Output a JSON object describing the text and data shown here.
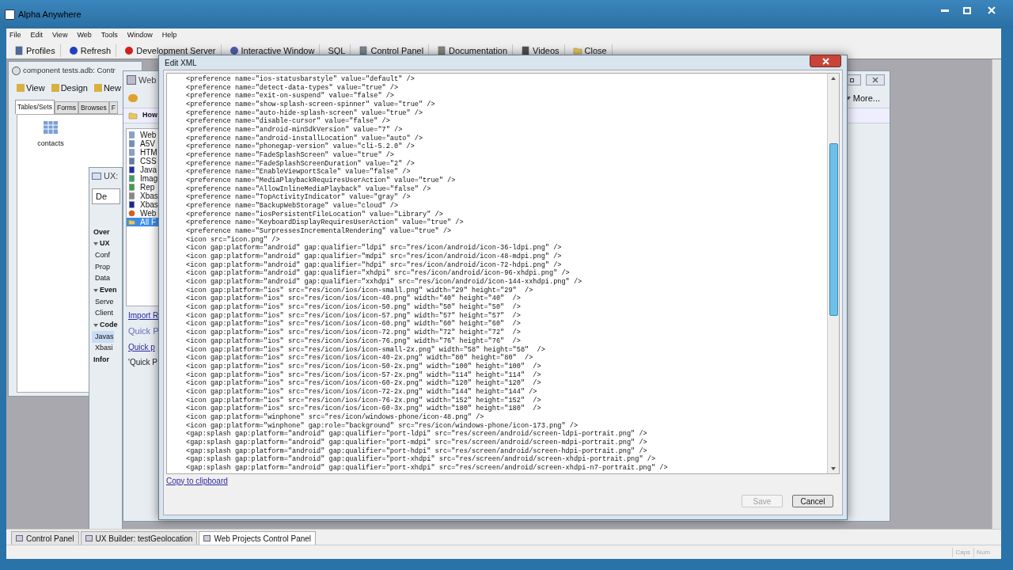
{
  "app": {
    "title": "Alpha Anywhere"
  },
  "menu": [
    "File",
    "Edit",
    "View",
    "Web",
    "Tools",
    "Window",
    "Help"
  ],
  "toolbar": [
    {
      "label": "Profiles",
      "kind": "monitor"
    },
    {
      "label": "Refresh",
      "kind": "refresh"
    },
    {
      "label": "Development Server",
      "kind": "dot"
    },
    {
      "label": "Interactive Window",
      "kind": "globe"
    },
    {
      "label": "SQL",
      "kind": "none"
    },
    {
      "label": "Control Panel",
      "kind": "panel"
    },
    {
      "label": "Documentation",
      "kind": "book"
    },
    {
      "label": "Videos",
      "kind": "film"
    },
    {
      "label": "Close",
      "kind": "folder"
    }
  ],
  "component_window": {
    "title": "component tests.adb: Contr",
    "toolbar": [
      "View",
      "Design",
      "New"
    ],
    "tabs": [
      {
        "label": "Tables/Sets",
        "selected": true
      },
      {
        "label": "Forms",
        "selected": false
      },
      {
        "label": "Browses",
        "selected": false
      },
      {
        "label": "F",
        "selected": false
      }
    ],
    "items": [
      "contacts"
    ]
  },
  "ux_window": {
    "title": "UX:",
    "button": "De",
    "entries": [
      {
        "label": "Over",
        "kind": "header",
        "selected": false
      },
      {
        "label": "UX",
        "kind": "group",
        "selected": false
      },
      {
        "label": "Conf",
        "kind": "item",
        "selected": false
      },
      {
        "label": "Prop",
        "kind": "item",
        "selected": false
      },
      {
        "label": "Data",
        "kind": "item",
        "selected": false
      },
      {
        "label": "Even",
        "kind": "group",
        "selected": false
      },
      {
        "label": "Serve",
        "kind": "item",
        "selected": false
      },
      {
        "label": "Client",
        "kind": "item",
        "selected": false
      },
      {
        "label": "Code",
        "kind": "group",
        "selected": false
      },
      {
        "label": "Javas",
        "kind": "item",
        "selected": true
      },
      {
        "label": "Xbasi",
        "kind": "item",
        "selected": false
      },
      {
        "label": "Infor",
        "kind": "header",
        "selected": false
      }
    ]
  },
  "web_window": {
    "title": "Web",
    "header": "How",
    "more": "More...",
    "files": [
      {
        "label": "Web",
        "kind": "page",
        "selected": false
      },
      {
        "label": "A5V",
        "kind": "pages",
        "selected": false
      },
      {
        "label": "HTM",
        "kind": "page",
        "selected": false
      },
      {
        "label": "CSS",
        "kind": "css",
        "selected": false
      },
      {
        "label": "Java",
        "kind": "js",
        "selected": false
      },
      {
        "label": "Imag",
        "kind": "image",
        "selected": false
      },
      {
        "label": "Rep",
        "kind": "report",
        "selected": false
      },
      {
        "label": "Xbas",
        "kind": "book",
        "selected": false
      },
      {
        "label": "Xbas",
        "kind": "xb",
        "selected": false
      },
      {
        "label": "Web",
        "kind": "ball",
        "selected": false
      },
      {
        "label": "All F",
        "kind": "folder",
        "selected": true
      }
    ],
    "links": [
      {
        "label": "Import R",
        "kind": "link"
      },
      {
        "label": "Quick P",
        "kind": "heading"
      },
      {
        "label": "Quick p",
        "kind": "link"
      },
      {
        "label": "'Quick P",
        "kind": "text"
      }
    ]
  },
  "dialog": {
    "title": "Edit XML",
    "link": "Copy to clipboard",
    "lines": [
      "<preference name=\"ios-statusbarstyle\" value=\"default\" />",
      "<preference name=\"detect-data-types\" value=\"true\" />",
      "<preference name=\"exit-on-suspend\" value=\"false\" />",
      "<preference name=\"show-splash-screen-spinner\" value=\"true\" />",
      "<preference name=\"auto-hide-splash-screen\" value=\"true\" />",
      "<preference name=\"disable-cursor\" value=\"false\" />",
      "<preference name=\"android-minSdkVersion\" value=\"7\" />",
      "<preference name=\"android-installLocation\" value=\"auto\" />",
      "<preference name=\"phonegap-version\" value=\"cli-5.2.0\" />",
      "<preference name=\"FadeSplashScreen\" value=\"true\" />",
      "<preference name=\"FadeSplashScreenDuration\" value=\"2\" />",
      "<preference name=\"EnableViewportScale\" value=\"false\" />",
      "<preference name=\"MediaPlaybackRequiresUserAction\" value=\"true\" />",
      "<preference name=\"AllowInlineMediaPlayback\" value=\"false\" />",
      "<preference name=\"TopActivityIndicator\" value=\"gray\" />",
      "<preference name=\"BackupWebStorage\" value=\"cloud\" />",
      "<preference name=\"iosPersistentFileLocation\" value=\"Library\" />",
      "<preference name=\"KeyboardDisplayRequiresUserAction\" value=\"true\" />",
      "<preference name=\"SurpressesIncrementalRendering\" value=\"true\" />",
      "<icon src=\"icon.png\" />",
      "<icon gap:platform=\"android\" gap:qualifier=\"ldpi\" src=\"res/icon/android/icon-36-ldpi.png\" />",
      "<icon gap:platform=\"android\" gap:qualifier=\"mdpi\" src=\"res/icon/android/icon-48-mdpi.png\" />",
      "<icon gap:platform=\"android\" gap:qualifier=\"hdpi\" src=\"res/icon/android/icon-72-hdpi.png\" />",
      "<icon gap:platform=\"android\" gap:qualifier=\"xhdpi\" src=\"res/icon/android/icon-96-xhdpi.png\" />",
      "<icon gap:platform=\"android\" gap:qualifier=\"xxhdpi\" src=\"res/icon/android/icon-144-xxhdpi.png\" />",
      "<icon gap:platform=\"ios\" src=\"res/icon/ios/icon-small.png\" width=\"29\" height=\"29\"  />",
      "<icon gap:platform=\"ios\" src=\"res/icon/ios/icon-40.png\" width=\"40\" height=\"40\"  />",
      "<icon gap:platform=\"ios\" src=\"res/icon/ios/icon-50.png\" width=\"50\" height=\"50\"  />",
      "<icon gap:platform=\"ios\" src=\"res/icon/ios/icon-57.png\" width=\"57\" height=\"57\"  />",
      "<icon gap:platform=\"ios\" src=\"res/icon/ios/icon-60.png\" width=\"60\" height=\"60\"  />",
      "<icon gap:platform=\"ios\" src=\"res/icon/ios/icon-72.png\" width=\"72\" height=\"72\"  />",
      "<icon gap:platform=\"ios\" src=\"res/icon/ios/icon-76.png\" width=\"76\" height=\"76\"  />",
      "<icon gap:platform=\"ios\" src=\"res/icon/ios/icon-small-2x.png\" width=\"58\" height=\"58\"  />",
      "<icon gap:platform=\"ios\" src=\"res/icon/ios/icon-40-2x.png\" width=\"80\" height=\"80\"  />",
      "<icon gap:platform=\"ios\" src=\"res/icon/ios/icon-50-2x.png\" width=\"100\" height=\"100\"  />",
      "<icon gap:platform=\"ios\" src=\"res/icon/ios/icon-57-2x.png\" width=\"114\" height=\"114\"  />",
      "<icon gap:platform=\"ios\" src=\"res/icon/ios/icon-60-2x.png\" width=\"120\" height=\"120\"  />",
      "<icon gap:platform=\"ios\" src=\"res/icon/ios/icon-72-2x.png\" width=\"144\" height=\"144\" />",
      "<icon gap:platform=\"ios\" src=\"res/icon/ios/icon-76-2x.png\" width=\"152\" height=\"152\"  />",
      "<icon gap:platform=\"ios\" src=\"res/icon/ios/icon-60-3x.png\" width=\"180\" height=\"180\"  />",
      "<icon gap:platform=\"winphone\" src=\"res/icon/windows-phone/icon-48.png\" />",
      "<icon gap:platform=\"winphone\" gap:role=\"background\" src=\"res/icon/windows-phone/icon-173.png\" />",
      "<gap:splash gap:platform=\"android\" gap:qualifier=\"port-ldpi\" src=\"res/screen/android/screen-ldpi-portrait.png\" />",
      "<gap:splash gap:platform=\"android\" gap:qualifier=\"port-mdpi\" src=\"res/screen/android/screen-mdpi-portrait.png\" />",
      "<gap:splash gap:platform=\"android\" gap:qualifier=\"port-hdpi\" src=\"res/screen/android/screen-hdpi-portrait.png\" />",
      "<gap:splash gap:platform=\"android\" gap:qualifier=\"port-xhdpi\" src=\"res/screen/android/screen-xhdpi-portrait.png\" />",
      "<gap:splash gap:platform=\"android\" gap:qualifier=\"port-xhdpi\" src=\"res/screen/android/screen-xhdpi-n7-portrait.png\" />"
    ],
    "buttons": [
      {
        "label": "Save",
        "disabled": true
      },
      {
        "label": "Cancel",
        "disabled": false
      }
    ]
  },
  "tabs": [
    {
      "label": "Control Panel",
      "selected": false
    },
    {
      "label": "UX Builder: testGeolocation",
      "selected": false
    },
    {
      "label": "Web Projects Control Panel",
      "selected": true
    }
  ],
  "status": [
    "Caps",
    "Num"
  ]
}
